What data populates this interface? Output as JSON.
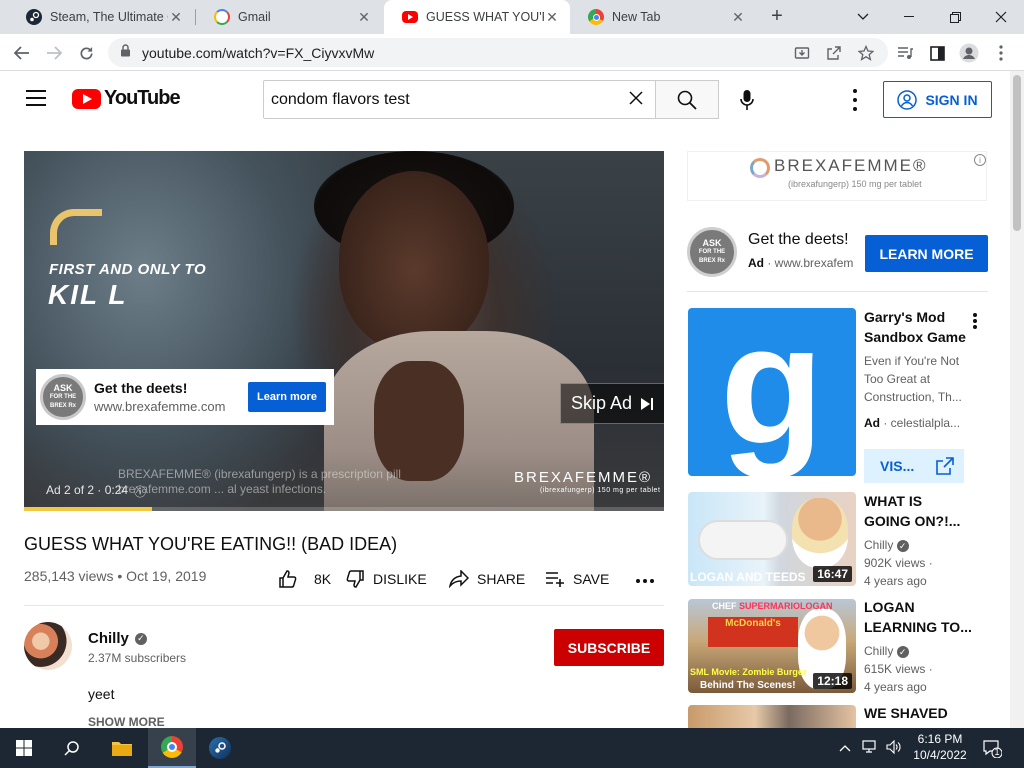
{
  "browser": {
    "tabs": [
      {
        "title": "Steam, The Ultimate Online Game Platform",
        "favicon": "steam-icon",
        "active": false
      },
      {
        "title": "Gmail",
        "favicon": "google-icon",
        "active": false
      },
      {
        "title": "GUESS WHAT YOU'RE EATING!! (BAD IDEA)",
        "favicon": "youtube-icon",
        "active": true
      },
      {
        "title": "New Tab",
        "favicon": "chrome-icon",
        "active": false
      }
    ],
    "url": "youtube.com/watch?v=FX_CiyvxvMw"
  },
  "youtube": {
    "logo_text": "YouTube",
    "search_value": "condom flavors test",
    "sign_in": "SIGN IN",
    "video": {
      "overlay_line1": "FIRST AND ONLY TO",
      "overlay_line2": "KIL L",
      "ad_card_title": "Get the deets!",
      "ad_card_url": "www.brexafemme.com",
      "ad_card_cta": "Learn more",
      "ask_badge": [
        "ASK",
        "FOR THE",
        "BREX Rx"
      ],
      "skip_ad": "Skip Ad",
      "disclaimer_line1": "BREXAFEMME® (ibrexafungerp) is a prescription pill",
      "disclaimer_line2": "brexafemme.com ... al yeast infections.",
      "ad_info": "Ad 2 of 2 · 0:24",
      "watermark": "BREXAFEMME®",
      "watermark_sub": "(ibrexafungerp) 150 mg per tablet",
      "ad_progress": 0.2
    },
    "title": "GUESS WHAT YOU'RE EATING!! (BAD IDEA)",
    "views_date": "285,143 views • Oct 19, 2019",
    "actions": {
      "likes": "8K",
      "dislike": "DISLIKE",
      "share": "SHARE",
      "save": "SAVE"
    },
    "channel": {
      "name": "Chilly",
      "subscribers": "2.37M subscribers",
      "subscribe": "SUBSCRIBE",
      "description": "yeet",
      "show_more": "SHOW MORE"
    },
    "sidebar": {
      "banner_brand": "BREXAFEMME®",
      "banner_sub": "(ibrexafungerp) 150 mg per tablet",
      "brand_title": "Get the deets!",
      "brand_ad_label": "Ad",
      "brand_url": "· www.brexafem",
      "brand_cta": "LEARN MORE",
      "promo": {
        "title_line1": "Garry's Mod",
        "title_line2": "Sandbox Game",
        "desc_line1": "Even if You're Not",
        "desc_line2": "Too Great at",
        "desc_line3": "Construction, Th...",
        "ad_label": "Ad",
        "advertiser": "· celestialpla...",
        "visit": "VIS...",
        "thumb_letter": "g"
      },
      "recommendations": [
        {
          "title_line1": "WHAT IS",
          "title_line2": "GOING ON?!...",
          "channel": "Chilly",
          "views": "902K views ·",
          "age": "4 years ago",
          "duration": "16:47",
          "caption": "LOGAN AND TEEDS"
        },
        {
          "title_line1": "LOGAN",
          "title_line2": "LEARNING TO...",
          "channel": "Chilly",
          "views": "615K views ·",
          "age": "4 years ago",
          "duration": "12:18",
          "caption_top_a": "CHEF",
          "caption_top_b": "SUPERMARIOLOGAN",
          "caption_sign": "McDonald's",
          "caption_b1": "SML Movie: Zombie Burger",
          "caption_b2": "Behind The Scenes!"
        },
        {
          "title_line1": "WE SHAVED"
        }
      ]
    }
  },
  "taskbar": {
    "time": "6:16 PM",
    "date": "10/4/2022",
    "notification_count": "1"
  },
  "colors": {
    "youtube_red": "#ff0000",
    "link_blue": "#065fd4",
    "subscribe_red": "#cc0000",
    "taskbar_bg": "#1c2733"
  }
}
